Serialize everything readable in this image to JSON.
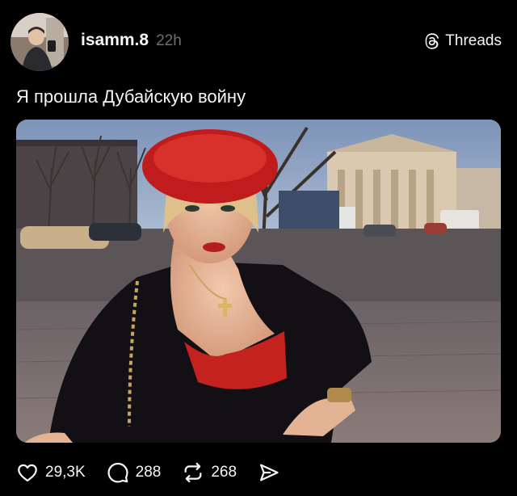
{
  "post": {
    "username": "isamm.8",
    "timestamp": "22h",
    "caption": "Я прошла Дубайскую войну",
    "photo_icon": "woman-in-red-beret-photo"
  },
  "brand": {
    "label": "Threads",
    "icon": "threads-logo-icon"
  },
  "actions": {
    "likes": "29,3K",
    "replies": "288",
    "reposts": "268",
    "like_icon": "heart-icon",
    "reply_icon": "speech-bubble-icon",
    "repost_icon": "repost-icon",
    "share_icon": "send-icon"
  },
  "colors": {
    "background": "#000000",
    "text": "#f3f5f7",
    "muted": "#6c7073"
  }
}
